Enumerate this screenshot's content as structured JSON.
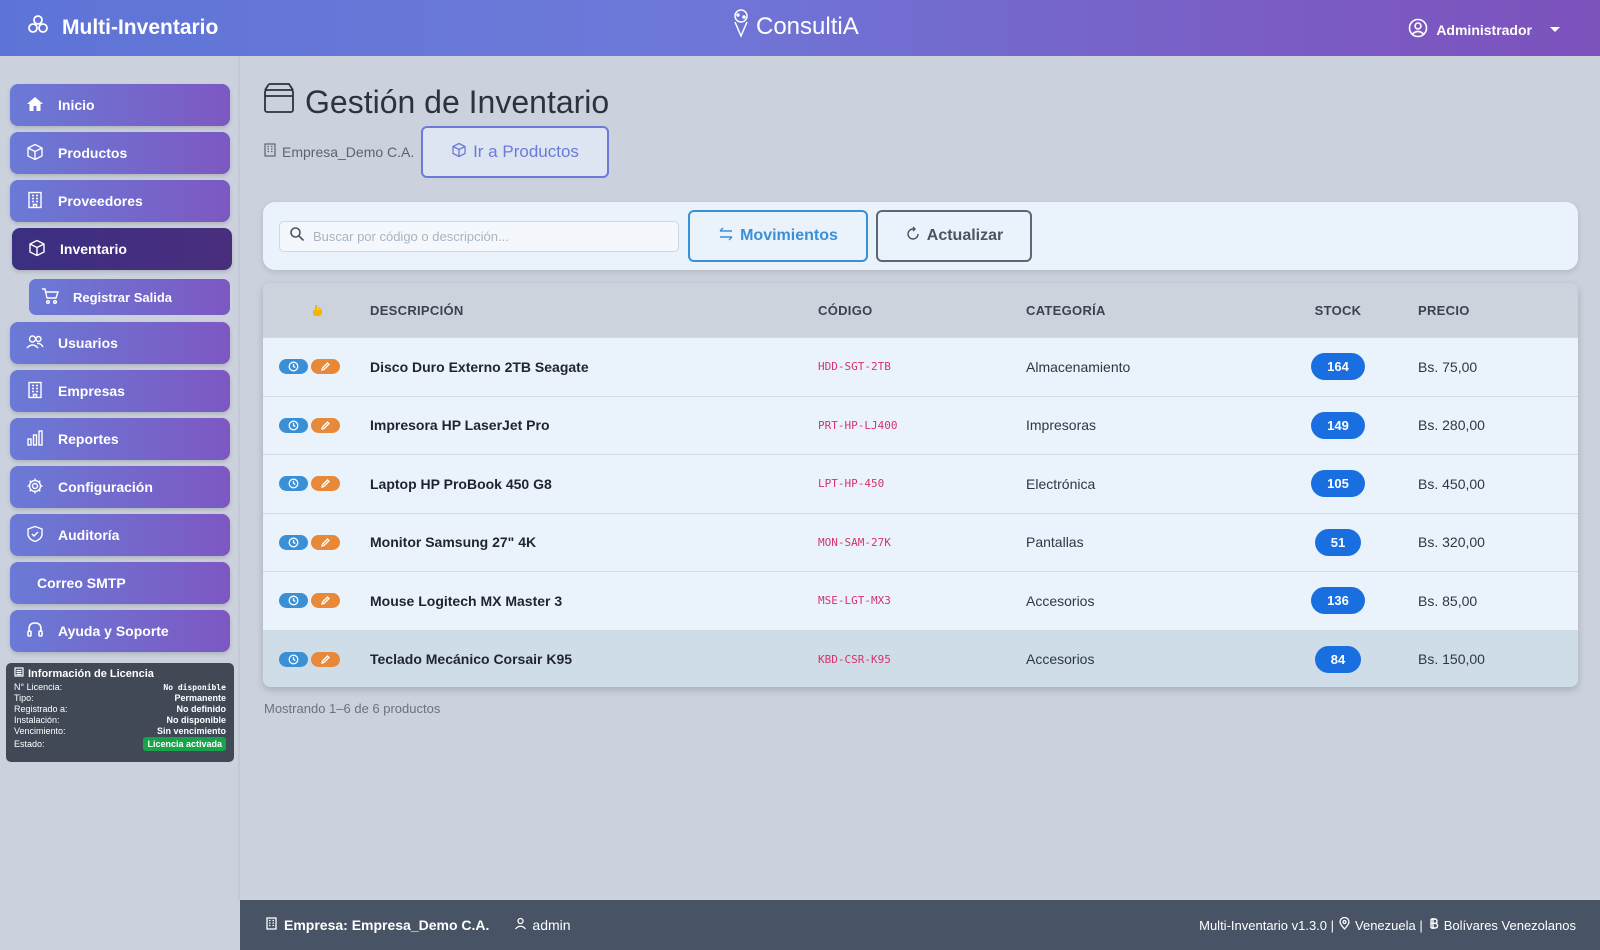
{
  "header": {
    "app_title": "Multi-Inventario",
    "center_brand": "ConsultiA",
    "user_label": "Administrador"
  },
  "sidebar": {
    "items": [
      {
        "label": "Inicio",
        "icon": "home-icon"
      },
      {
        "label": "Productos",
        "icon": "box-icon"
      },
      {
        "label": "Proveedores",
        "icon": "building-icon"
      },
      {
        "label": "Inventario",
        "icon": "box-icon",
        "active": true
      },
      {
        "label": "Registrar Salida",
        "icon": "cart-icon",
        "sub": true
      },
      {
        "label": "Usuarios",
        "icon": "users-icon"
      },
      {
        "label": "Empresas",
        "icon": "building-icon"
      },
      {
        "label": "Reportes",
        "icon": "chart-icon"
      },
      {
        "label": "Configuración",
        "icon": "gear-icon"
      },
      {
        "label": "Auditoría",
        "icon": "shield-icon"
      },
      {
        "label": "Correo SMTP",
        "icon": ""
      },
      {
        "label": "Ayuda y Soporte",
        "icon": "headset-icon"
      }
    ],
    "license": {
      "title": "Información de Licencia",
      "rows": [
        {
          "label": "N° Licencia:",
          "value": "No disponible"
        },
        {
          "label": "Tipo:",
          "value": "Permanente"
        },
        {
          "label": "Registrado a:",
          "value": "No definido"
        },
        {
          "label": "Instalación:",
          "value": "No disponible"
        },
        {
          "label": "Vencimiento:",
          "value": "Sin vencimiento"
        },
        {
          "label": "Estado:",
          "value": "Licencia activada"
        }
      ]
    }
  },
  "main": {
    "title": "Gestión de Inventario",
    "company": "Empresa_Demo C.A.",
    "go_products_label": "Ir a Productos",
    "search_placeholder": "Buscar por código o descripción...",
    "movements_label": "Movimientos",
    "refresh_label": "Actualizar",
    "table": {
      "headers": {
        "desc": "DESCRIPCIÓN",
        "code": "CÓDIGO",
        "category": "CATEGORÍA",
        "stock": "STOCK",
        "price": "PRECIO"
      },
      "rows": [
        {
          "desc": "Disco Duro Externo 2TB Seagate",
          "code": "HDD-SGT-2TB",
          "category": "Almacenamiento",
          "stock": "164",
          "price": "Bs. 75,00"
        },
        {
          "desc": "Impresora HP LaserJet Pro",
          "code": "PRT-HP-LJ400",
          "category": "Impresoras",
          "stock": "149",
          "price": "Bs. 280,00"
        },
        {
          "desc": "Laptop HP ProBook 450 G8",
          "code": "LPT-HP-450",
          "category": "Electrónica",
          "stock": "105",
          "price": "Bs. 450,00"
        },
        {
          "desc": "Monitor Samsung 27\" 4K",
          "code": "MON-SAM-27K",
          "category": "Pantallas",
          "stock": "51",
          "price": "Bs. 320,00"
        },
        {
          "desc": "Mouse Logitech MX Master 3",
          "code": "MSE-LGT-MX3",
          "category": "Accesorios",
          "stock": "136",
          "price": "Bs. 85,00"
        },
        {
          "desc": "Teclado Mecánico Corsair K95",
          "code": "KBD-CSR-K95",
          "category": "Accesorios",
          "stock": "84",
          "price": "Bs. 150,00"
        }
      ]
    },
    "pager_text": "Mostrando 1–6 de 6 productos"
  },
  "footer": {
    "company": "Empresa: Empresa_Demo C.A.",
    "user": "admin",
    "version": "Multi-Inventario v1.3.0 |",
    "country": "Venezuela |",
    "currency": "Bolívares Venezolanos"
  },
  "colors": {
    "accent": "#6b7bd8",
    "primary_blue": "#1a6fe0",
    "code_pink": "#d6336c",
    "edit_orange": "#e8893a"
  }
}
